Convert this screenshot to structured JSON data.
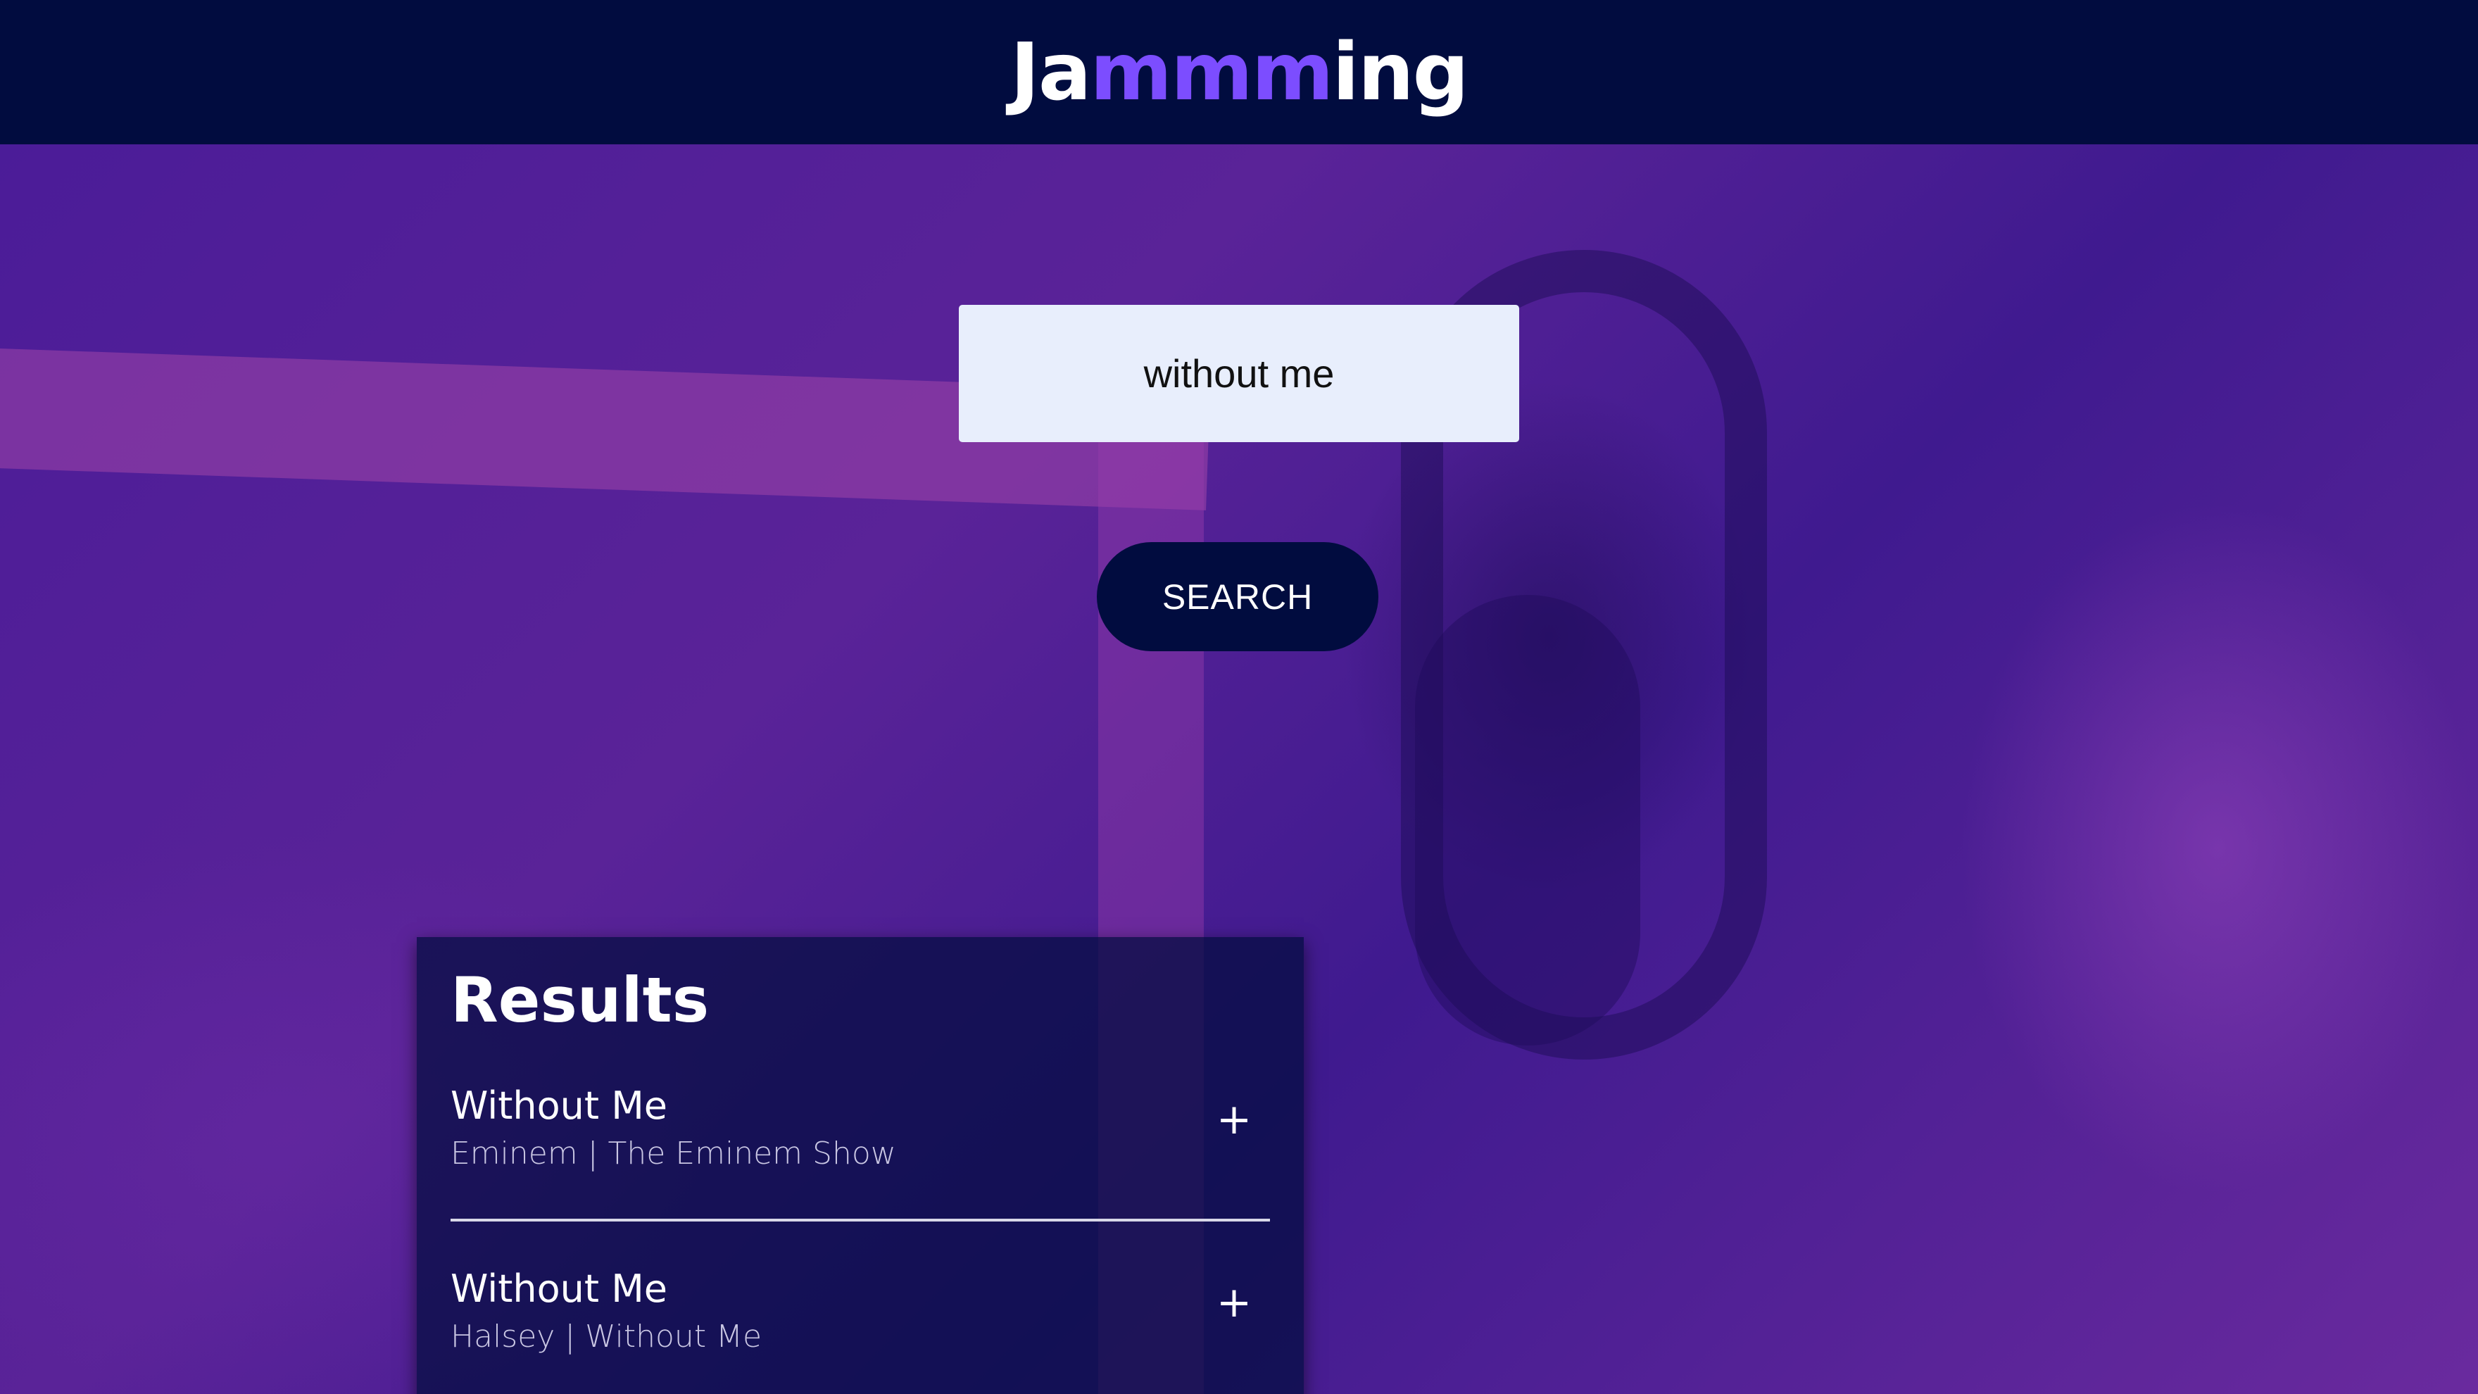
{
  "header": {
    "logo_prefix": "Ja",
    "logo_accent": "mmm",
    "logo_suffix": "ing",
    "background_color": "#010c3f",
    "accent_color": "#7c4dff"
  },
  "search": {
    "value": "without me",
    "button_label": "SEARCH"
  },
  "results": {
    "title": "Results",
    "tracks": [
      {
        "name": "Without Me",
        "info": "Eminem | The Eminem Show",
        "action_icon": "plus-icon",
        "action_label": "+"
      },
      {
        "name": "Without Me",
        "info": "Halsey | Without Me",
        "action_icon": "plus-icon",
        "action_label": "+"
      }
    ]
  },
  "colors": {
    "background": "#4a1e96",
    "panel": "#010c3f",
    "input_background": "#e8eefc"
  }
}
